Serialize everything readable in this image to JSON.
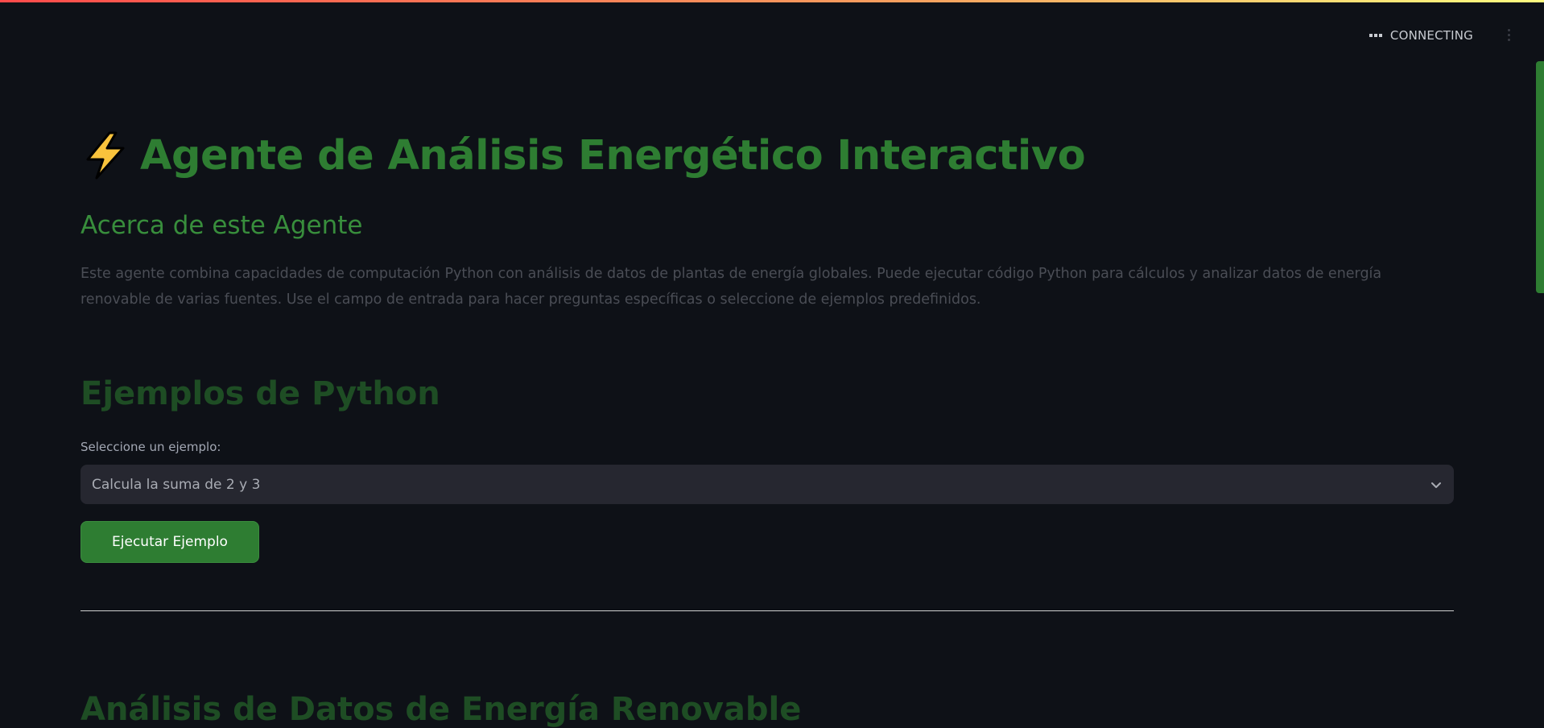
{
  "status": {
    "label": "CONNECTING",
    "icon": "ellipsis-icon"
  },
  "header": {
    "title": "Agente de Análisis Energético Interactivo",
    "title_icon": "lightning-bolt-icon",
    "title_color": "#2e7d32"
  },
  "about": {
    "heading": "Acerca de este Agente",
    "text": "Este agente combina capacidades de computación Python con análisis de datos de plantas de energía globales. Puede ejecutar código Python para cálculos y analizar datos de energía renovable de varias fuentes. Use el campo de entrada para hacer preguntas específicas o seleccione de ejemplos predefinidos."
  },
  "examples": {
    "heading": "Ejemplos de Python",
    "select_label": "Seleccione un ejemplo:",
    "selected_value": "Calcula la suma de 2 y 3",
    "run_button_label": "Ejecutar Ejemplo"
  },
  "next_section": {
    "heading": "Análisis de Datos de Energía Renovable"
  },
  "colors": {
    "background": "#0e1117",
    "accent": "#2e7d32",
    "select_bg": "#262730"
  }
}
